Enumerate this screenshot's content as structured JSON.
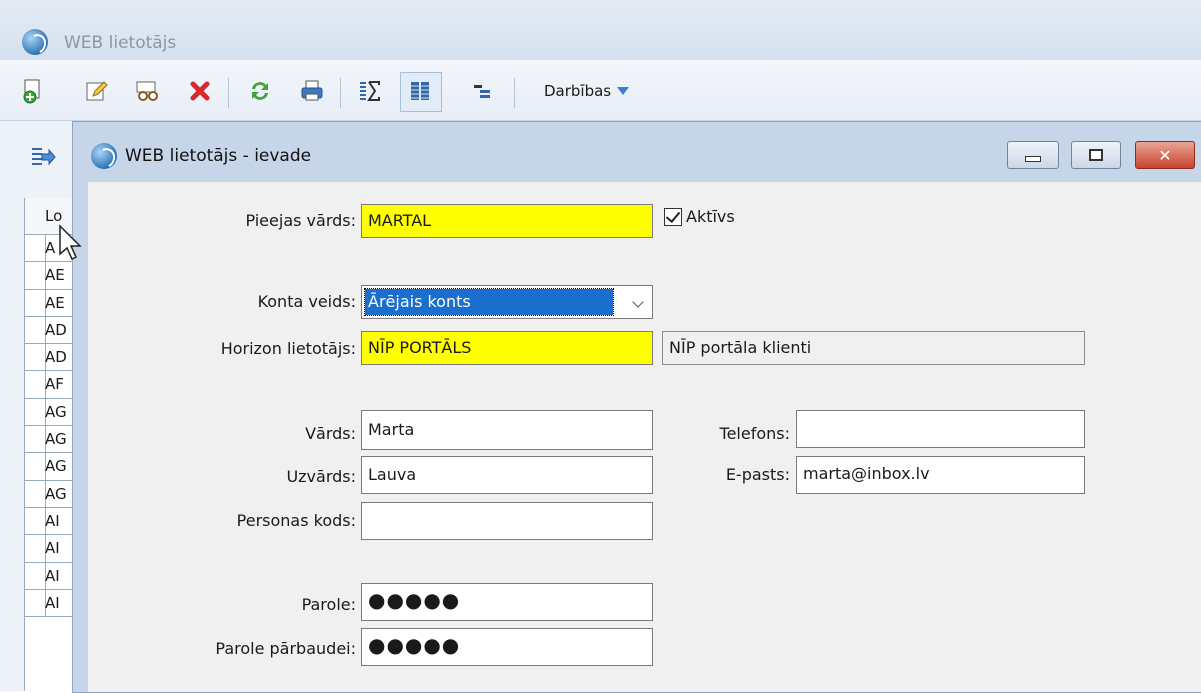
{
  "main_window": {
    "title": "WEB lietotājs",
    "toolbar": {
      "darbibas_label": "Darbības"
    },
    "grid": {
      "header": "Lo",
      "rows": [
        "A",
        "AE",
        "AE",
        "AD",
        "AD",
        "AF",
        "AG",
        "AG",
        "AG",
        "AG",
        "AI",
        "AI",
        "AI",
        "AI"
      ]
    }
  },
  "dialog": {
    "title": "WEB lietotājs - ievade",
    "fields": {
      "pieejas_vards": {
        "label": "Pieejas vārds:",
        "value": "MARTAL"
      },
      "aktivs": {
        "label": "Aktīvs",
        "checked": true
      },
      "konta_veids": {
        "label": "Konta veids:",
        "value": "Ārējais konts"
      },
      "horizon_lietotajs": {
        "label": "Horizon lietotājs:",
        "value": "NĪP PORTĀLS",
        "description": "NĪP portāla klienti"
      },
      "vards": {
        "label": "Vārds:",
        "value": "Marta"
      },
      "uzvards": {
        "label": "Uzvārds:",
        "value": "Lauva"
      },
      "personas_kods": {
        "label": "Personas kods:",
        "value": ""
      },
      "telefons": {
        "label": "Telefons:",
        "value": ""
      },
      "e_pasts": {
        "label": "E-pasts:",
        "value": "marta@inbox.lv"
      },
      "parole": {
        "label": "Parole:",
        "value": "●●●●●"
      },
      "parole_parbaudei": {
        "label": "Parole pārbaudei:",
        "value": "●●●●●"
      }
    }
  },
  "colors": {
    "required_field": "#ffff00",
    "selection": "#1a6fce",
    "title_bar": "#c7d5e8"
  }
}
